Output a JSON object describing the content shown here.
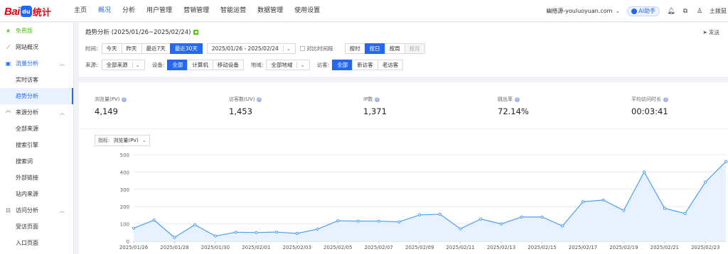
{
  "brand": {
    "logo_text": "Bai",
    "logo_mark": "du",
    "logo_suffix": "统计"
  },
  "nav": [
    "主页",
    "概况",
    "分析",
    "用户管理",
    "营销管理",
    "智能运营",
    "数据管理",
    "使用设置"
  ],
  "header": {
    "site": "幽络源-youluoyuan.com",
    "ai_label": "AI助手",
    "user": "土拨鼠"
  },
  "sidebar": {
    "free": "免费版",
    "items": [
      {
        "label": "网站概况",
        "type": "group"
      },
      {
        "label": "流量分析",
        "type": "group-open"
      },
      {
        "label": "实时访客",
        "type": "sub"
      },
      {
        "label": "趋势分析",
        "type": "sub-selected"
      },
      {
        "label": "来源分析",
        "type": "group"
      },
      {
        "label": "全部来源",
        "type": "sub"
      },
      {
        "label": "搜索引擎",
        "type": "sub"
      },
      {
        "label": "搜索词",
        "type": "sub"
      },
      {
        "label": "外部链接",
        "type": "sub"
      },
      {
        "label": "站内来源",
        "type": "sub"
      },
      {
        "label": "访问分析",
        "type": "group"
      },
      {
        "label": "受访页面",
        "type": "sub"
      },
      {
        "label": "入口页面",
        "type": "sub"
      }
    ]
  },
  "page": {
    "title": "趋势分析 (2025/01/26~2025/02/24)",
    "send": "发送",
    "time_label": "时间:",
    "time_buttons": [
      "今天",
      "昨天",
      "最近7天",
      "最近30天"
    ],
    "date_range": "2025/01/26 - 2025/02/24",
    "compare": "对比时间段",
    "granularity": [
      "按时",
      "按日",
      "按周",
      "按月"
    ],
    "source_label": "来源:",
    "source_value": "全部来源",
    "device_label": "设备:",
    "device_buttons": [
      "全部",
      "计算机",
      "移动设备"
    ],
    "region_label": "地域:",
    "region_value": "全部地域",
    "visitor_label": "访客:",
    "visitor_buttons": [
      "全部",
      "新访客",
      "老访客"
    ]
  },
  "metrics": [
    {
      "label": "浏览量(PV)",
      "value": "4,149"
    },
    {
      "label": "访客数(UV)",
      "value": "1,453"
    },
    {
      "label": "IP数",
      "value": "1,371"
    },
    {
      "label": "跳出率",
      "value": "72.14%"
    },
    {
      "label": "平均访问时长",
      "value": "00:03:41"
    }
  ],
  "indicator": {
    "label": "指标:",
    "value": "浏览量(PV)"
  },
  "colors": {
    "accent": "#2468f2",
    "line": "#4a9ff5",
    "fill": "#e3efff"
  },
  "chart_data": {
    "type": "area",
    "x": [
      "2025/01/26",
      "2025/01/27",
      "2025/01/28",
      "2025/01/29",
      "2025/01/30",
      "2025/01/31",
      "2025/02/01",
      "2025/02/02",
      "2025/02/03",
      "2025/02/04",
      "2025/02/05",
      "2025/02/06",
      "2025/02/07",
      "2025/02/08",
      "2025/02/09",
      "2025/02/10",
      "2025/02/11",
      "2025/02/12",
      "2025/02/13",
      "2025/02/14",
      "2025/02/15",
      "2025/02/16",
      "2025/02/17",
      "2025/02/18",
      "2025/02/19",
      "2025/02/20",
      "2025/02/21",
      "2025/02/22",
      "2025/02/23",
      "2025/02/24"
    ],
    "x_tick_labels": [
      "2025/01/26",
      "2025/01/28",
      "2025/01/30",
      "2025/02/01",
      "2025/02/03",
      "2025/02/05",
      "2025/02/07",
      "2025/02/09",
      "2025/02/11",
      "2025/02/13",
      "2025/02/15",
      "2025/02/17",
      "2025/02/19",
      "2025/02/21",
      "2025/02/23"
    ],
    "series": [
      {
        "name": "浏览量(PV)",
        "values": [
          75,
          122,
          22,
          95,
          30,
          52,
          50,
          53,
          45,
          70,
          118,
          116,
          116,
          112,
          152,
          156,
          72,
          128,
          100,
          140,
          140,
          88,
          228,
          238,
          178,
          400,
          190,
          160,
          342,
          460
        ]
      }
    ],
    "ylim": [
      0,
      500
    ],
    "yticks": [
      0,
      100,
      200,
      300,
      400,
      500
    ],
    "grid": true
  }
}
